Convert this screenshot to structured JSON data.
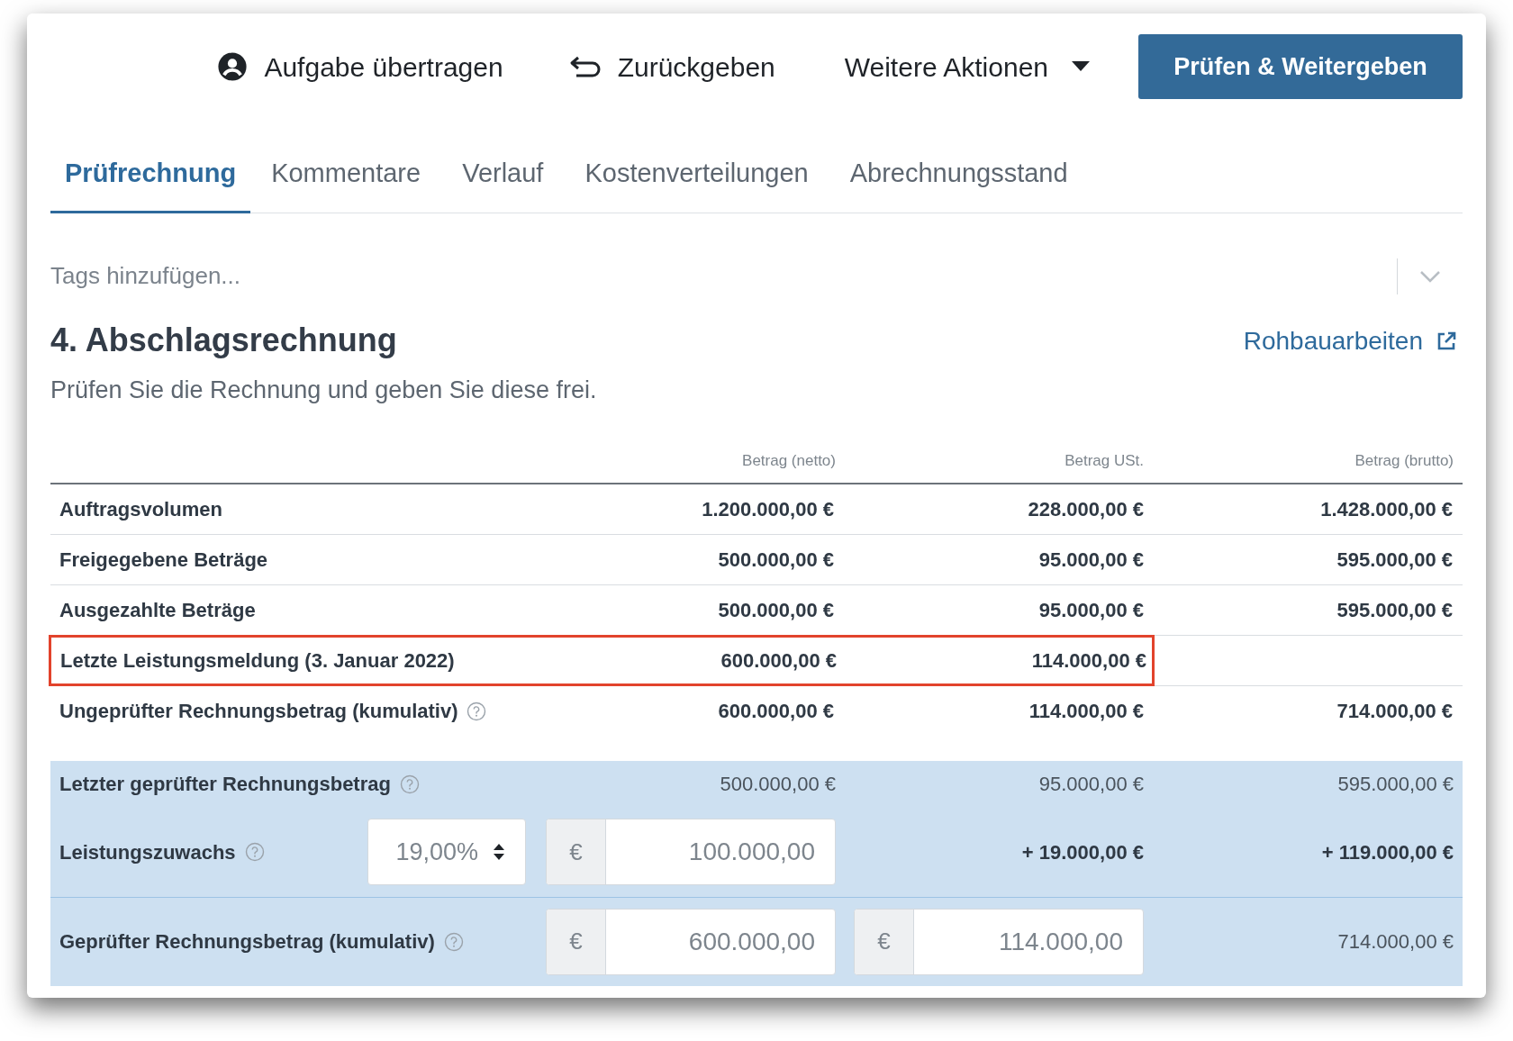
{
  "toolbar": [
    {
      "kind": "person",
      "label": "Aufgabe übertragen"
    },
    {
      "kind": "return",
      "label": "Zurückgeben"
    },
    {
      "kind": "menu",
      "label": "Weitere Aktionen"
    },
    {
      "kind": "primary",
      "label": "Prüfen & Weitergeben"
    }
  ],
  "tabs": [
    {
      "label": "Prüfrechnung",
      "selected": true
    },
    {
      "label": "Kommentare",
      "selected": false
    },
    {
      "label": "Verlauf",
      "selected": false
    },
    {
      "label": "Kostenverteilungen",
      "selected": false
    },
    {
      "label": "Abrechnungsstand",
      "selected": false
    }
  ],
  "tags_field": {
    "placeholder": "Tags hinzufügen..."
  },
  "heading": "4. Abschlagsrechnung",
  "subtitle": "Prüfen Sie die Rechnung und geben Sie diese frei.",
  "project_link": "Rohbauarbeiten",
  "table": {
    "columns": [
      "Betrag (netto)",
      "Betrag USt.",
      "Betrag (brutto)"
    ],
    "rows": [
      {
        "label": "Auftragsvolumen",
        "netto": "1.200.000,00 €",
        "ust": "228.000,00 €",
        "brutto": "1.428.000,00 €",
        "help": false,
        "highlighted": false
      },
      {
        "label": "Freigegebene Beträge",
        "netto": "500.000,00 €",
        "ust": "95.000,00 €",
        "brutto": "595.000,00 €",
        "help": false,
        "highlighted": false
      },
      {
        "label": "Ausgezahlte Beträge",
        "netto": "500.000,00 €",
        "ust": "95.000,00 €",
        "brutto": "595.000,00 €",
        "help": false,
        "highlighted": false
      },
      {
        "label": "Letzte Leistungsmeldung (3. Januar 2022)",
        "netto": "600.000,00 €",
        "ust": "114.000,00 €",
        "help": false,
        "highlighted": true
      },
      {
        "label": "Ungeprüfter Rechnungsbetrag (kumulativ)",
        "netto": "600.000,00 €",
        "ust": "114.000,00 €",
        "brutto": "714.000,00 €",
        "help": true,
        "highlighted": false
      }
    ]
  },
  "review": [
    {
      "kind": "readonly",
      "label": "Letzter geprüfter Rechnungsbetrag",
      "help": true,
      "netto": "500.000,00 €",
      "ust": "95.000,00 €",
      "brutto": "595.000,00 €"
    },
    {
      "kind": "increment",
      "label": "Leistungszuwachs",
      "help": true,
      "rate": "19,00%",
      "netto_field": {
        "prefix": "€",
        "value": "100.000,00"
      },
      "ust": "+ 19.000,00 €",
      "brutto": "+ 119.000,00 €"
    },
    {
      "kind": "fields",
      "label": "Geprüfter Rechnungsbetrag (kumulativ)",
      "help": true,
      "netto_field": {
        "prefix": "€",
        "value": "600.000,00"
      },
      "ust_field": {
        "prefix": "€",
        "value": "114.000,00"
      },
      "brutto": "714.000,00 €"
    }
  ]
}
